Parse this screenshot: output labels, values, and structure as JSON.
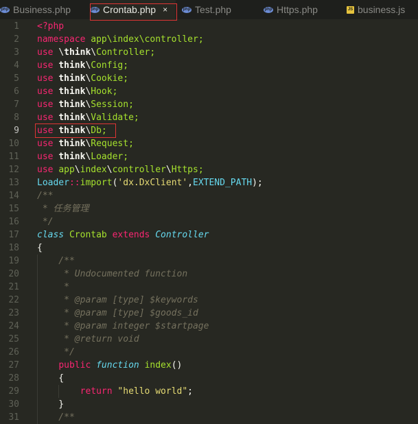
{
  "tabs": [
    {
      "label": "Business.php",
      "icon": "php-icon",
      "active": false
    },
    {
      "label": "Crontab.php",
      "icon": "php-icon",
      "active": true
    },
    {
      "label": "Test.php",
      "icon": "php-icon",
      "active": false
    },
    {
      "label": "Https.php",
      "icon": "php-icon",
      "active": false
    },
    {
      "label": "business.js",
      "icon": "js-icon",
      "active": false
    }
  ],
  "close_glyph": "×",
  "current_line": 9,
  "lines": [
    {
      "n": "1",
      "indent": 0,
      "t": [
        [
          "<?php",
          "k"
        ]
      ]
    },
    {
      "n": "2",
      "indent": 0,
      "t": [
        [
          "namespace ",
          "k"
        ],
        [
          "app\\index\\controller;",
          "g"
        ]
      ]
    },
    {
      "n": "3",
      "indent": 0,
      "t": [
        [
          "use ",
          "k"
        ],
        [
          "\\",
          "w"
        ],
        [
          "think",
          "wb"
        ],
        [
          "\\",
          "w"
        ],
        [
          "Controller;",
          "g"
        ]
      ]
    },
    {
      "n": "4",
      "indent": 0,
      "t": [
        [
          "use ",
          "k"
        ],
        [
          "think",
          "wb"
        ],
        [
          "\\",
          "w"
        ],
        [
          "Config;",
          "g"
        ]
      ]
    },
    {
      "n": "5",
      "indent": 0,
      "t": [
        [
          "use ",
          "k"
        ],
        [
          "think",
          "wb"
        ],
        [
          "\\",
          "w"
        ],
        [
          "Cookie;",
          "g"
        ]
      ]
    },
    {
      "n": "6",
      "indent": 0,
      "t": [
        [
          "use ",
          "k"
        ],
        [
          "think",
          "wb"
        ],
        [
          "\\",
          "w"
        ],
        [
          "Hook;",
          "g"
        ]
      ]
    },
    {
      "n": "7",
      "indent": 0,
      "t": [
        [
          "use ",
          "k"
        ],
        [
          "think",
          "wb"
        ],
        [
          "\\",
          "w"
        ],
        [
          "Session;",
          "g"
        ]
      ]
    },
    {
      "n": "8",
      "indent": 0,
      "t": [
        [
          "use ",
          "k"
        ],
        [
          "think",
          "wb"
        ],
        [
          "\\",
          "w"
        ],
        [
          "Validate;",
          "g"
        ]
      ]
    },
    {
      "n": "9",
      "indent": 0,
      "t": [
        [
          "use ",
          "k"
        ],
        [
          "think",
          "wb"
        ],
        [
          "\\",
          "w"
        ],
        [
          "Db;",
          "g"
        ]
      ]
    },
    {
      "n": "10",
      "indent": 0,
      "t": [
        [
          "use ",
          "k"
        ],
        [
          "think",
          "wb"
        ],
        [
          "\\",
          "w"
        ],
        [
          "Request;",
          "g"
        ]
      ]
    },
    {
      "n": "11",
      "indent": 0,
      "t": [
        [
          "use ",
          "k"
        ],
        [
          "think",
          "wb"
        ],
        [
          "\\",
          "w"
        ],
        [
          "Loader;",
          "g"
        ]
      ]
    },
    {
      "n": "12",
      "indent": 0,
      "t": [
        [
          "use ",
          "k"
        ],
        [
          "app",
          "g"
        ],
        [
          "\\",
          "w"
        ],
        [
          "index",
          "g"
        ],
        [
          "\\",
          "w"
        ],
        [
          "controller",
          "g"
        ],
        [
          "\\",
          "w"
        ],
        [
          "Https;",
          "g"
        ]
      ]
    },
    {
      "n": "13",
      "indent": 0,
      "t": [
        [
          "Loader",
          "cy"
        ],
        [
          "::",
          "k"
        ],
        [
          "import",
          "g"
        ],
        [
          "(",
          "w"
        ],
        [
          "'dx.DxClient'",
          "s"
        ],
        [
          ",",
          "w"
        ],
        [
          "EXTEND_PATH",
          "cy"
        ],
        [
          ");",
          "w"
        ]
      ]
    },
    {
      "n": "14",
      "indent": 0,
      "t": [
        [
          "/**",
          "m"
        ]
      ]
    },
    {
      "n": "15",
      "indent": 0,
      "t": [
        [
          " * 任务管理",
          "m"
        ]
      ]
    },
    {
      "n": "16",
      "indent": 0,
      "t": [
        [
          " */",
          "m"
        ]
      ]
    },
    {
      "n": "17",
      "indent": 0,
      "t": [
        [
          "class ",
          "c"
        ],
        [
          "Crontab ",
          "g"
        ],
        [
          "extends ",
          "k"
        ],
        [
          "Controller",
          "c"
        ]
      ]
    },
    {
      "n": "18",
      "indent": 0,
      "t": [
        [
          "{",
          "w"
        ]
      ]
    },
    {
      "n": "19",
      "indent": 1,
      "t": [
        [
          "    /**",
          "m"
        ]
      ]
    },
    {
      "n": "20",
      "indent": 1,
      "t": [
        [
          "     * Undocumented function",
          "m"
        ]
      ]
    },
    {
      "n": "21",
      "indent": 1,
      "t": [
        [
          "     *",
          "m"
        ]
      ]
    },
    {
      "n": "22",
      "indent": 1,
      "t": [
        [
          "     * @param [type] $keywords",
          "m"
        ]
      ]
    },
    {
      "n": "23",
      "indent": 1,
      "t": [
        [
          "     * @param [type] $goods_id",
          "m"
        ]
      ]
    },
    {
      "n": "24",
      "indent": 1,
      "t": [
        [
          "     * @param integer $startpage",
          "m"
        ]
      ]
    },
    {
      "n": "25",
      "indent": 1,
      "t": [
        [
          "     * @return void",
          "m"
        ]
      ]
    },
    {
      "n": "26",
      "indent": 1,
      "t": [
        [
          "     */",
          "m"
        ]
      ]
    },
    {
      "n": "27",
      "indent": 1,
      "t": [
        [
          "    ",
          "w"
        ],
        [
          "public ",
          "k"
        ],
        [
          "function ",
          "c"
        ],
        [
          "index",
          "g"
        ],
        [
          "()",
          "w"
        ]
      ]
    },
    {
      "n": "28",
      "indent": 1,
      "t": [
        [
          "    {",
          "w"
        ]
      ]
    },
    {
      "n": "29",
      "indent": 2,
      "t": [
        [
          "        ",
          "w"
        ],
        [
          "return ",
          "k"
        ],
        [
          "\"hello world\"",
          "s"
        ],
        [
          ";",
          "w"
        ]
      ]
    },
    {
      "n": "30",
      "indent": 1,
      "t": [
        [
          "    }",
          "w"
        ]
      ]
    },
    {
      "n": "31",
      "indent": 1,
      "t": [
        [
          "    /**",
          "m"
        ]
      ]
    }
  ]
}
